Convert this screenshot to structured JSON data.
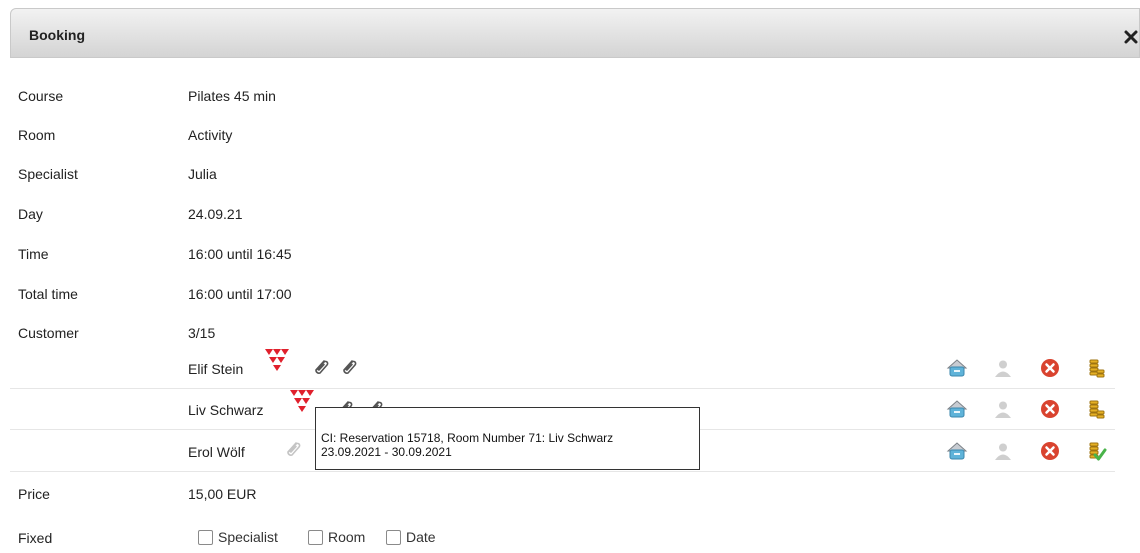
{
  "dialog": {
    "title": "Booking"
  },
  "fields": {
    "course": {
      "label": "Course",
      "value": "Pilates 45 min"
    },
    "room": {
      "label": "Room",
      "value": "Activity"
    },
    "specialist": {
      "label": "Specialist",
      "value": "Julia"
    },
    "day": {
      "label": "Day",
      "value": "24.09.21"
    },
    "time": {
      "label": "Time",
      "value": "16:00 until 16:45"
    },
    "total_time": {
      "label": "Total time",
      "value": "16:00 until 17:00"
    },
    "customer": {
      "label": "Customer",
      "value": "3/15"
    },
    "price": {
      "label": "Price",
      "value": "15,00 EUR"
    },
    "fixed": {
      "label": "Fixed"
    }
  },
  "customers": [
    {
      "name": "Elif Stein"
    },
    {
      "name": "Liv Schwarz"
    },
    {
      "name": "Erol Wölf"
    }
  ],
  "tooltip": {
    "line1": "CI: Reservation 15718, Room Number 71: Liv Schwarz",
    "line2": "23.09.2021 - 30.09.2021"
  },
  "fixed_options": [
    {
      "label": "Specialist",
      "checked": false
    },
    {
      "label": "Room",
      "checked": false
    },
    {
      "label": "Date",
      "checked": false
    }
  ],
  "colors": {
    "accent_red": "#e0202c",
    "cancel_red": "#d9432f",
    "coin_gold": "#e5b024",
    "check_green": "#49b34a"
  }
}
